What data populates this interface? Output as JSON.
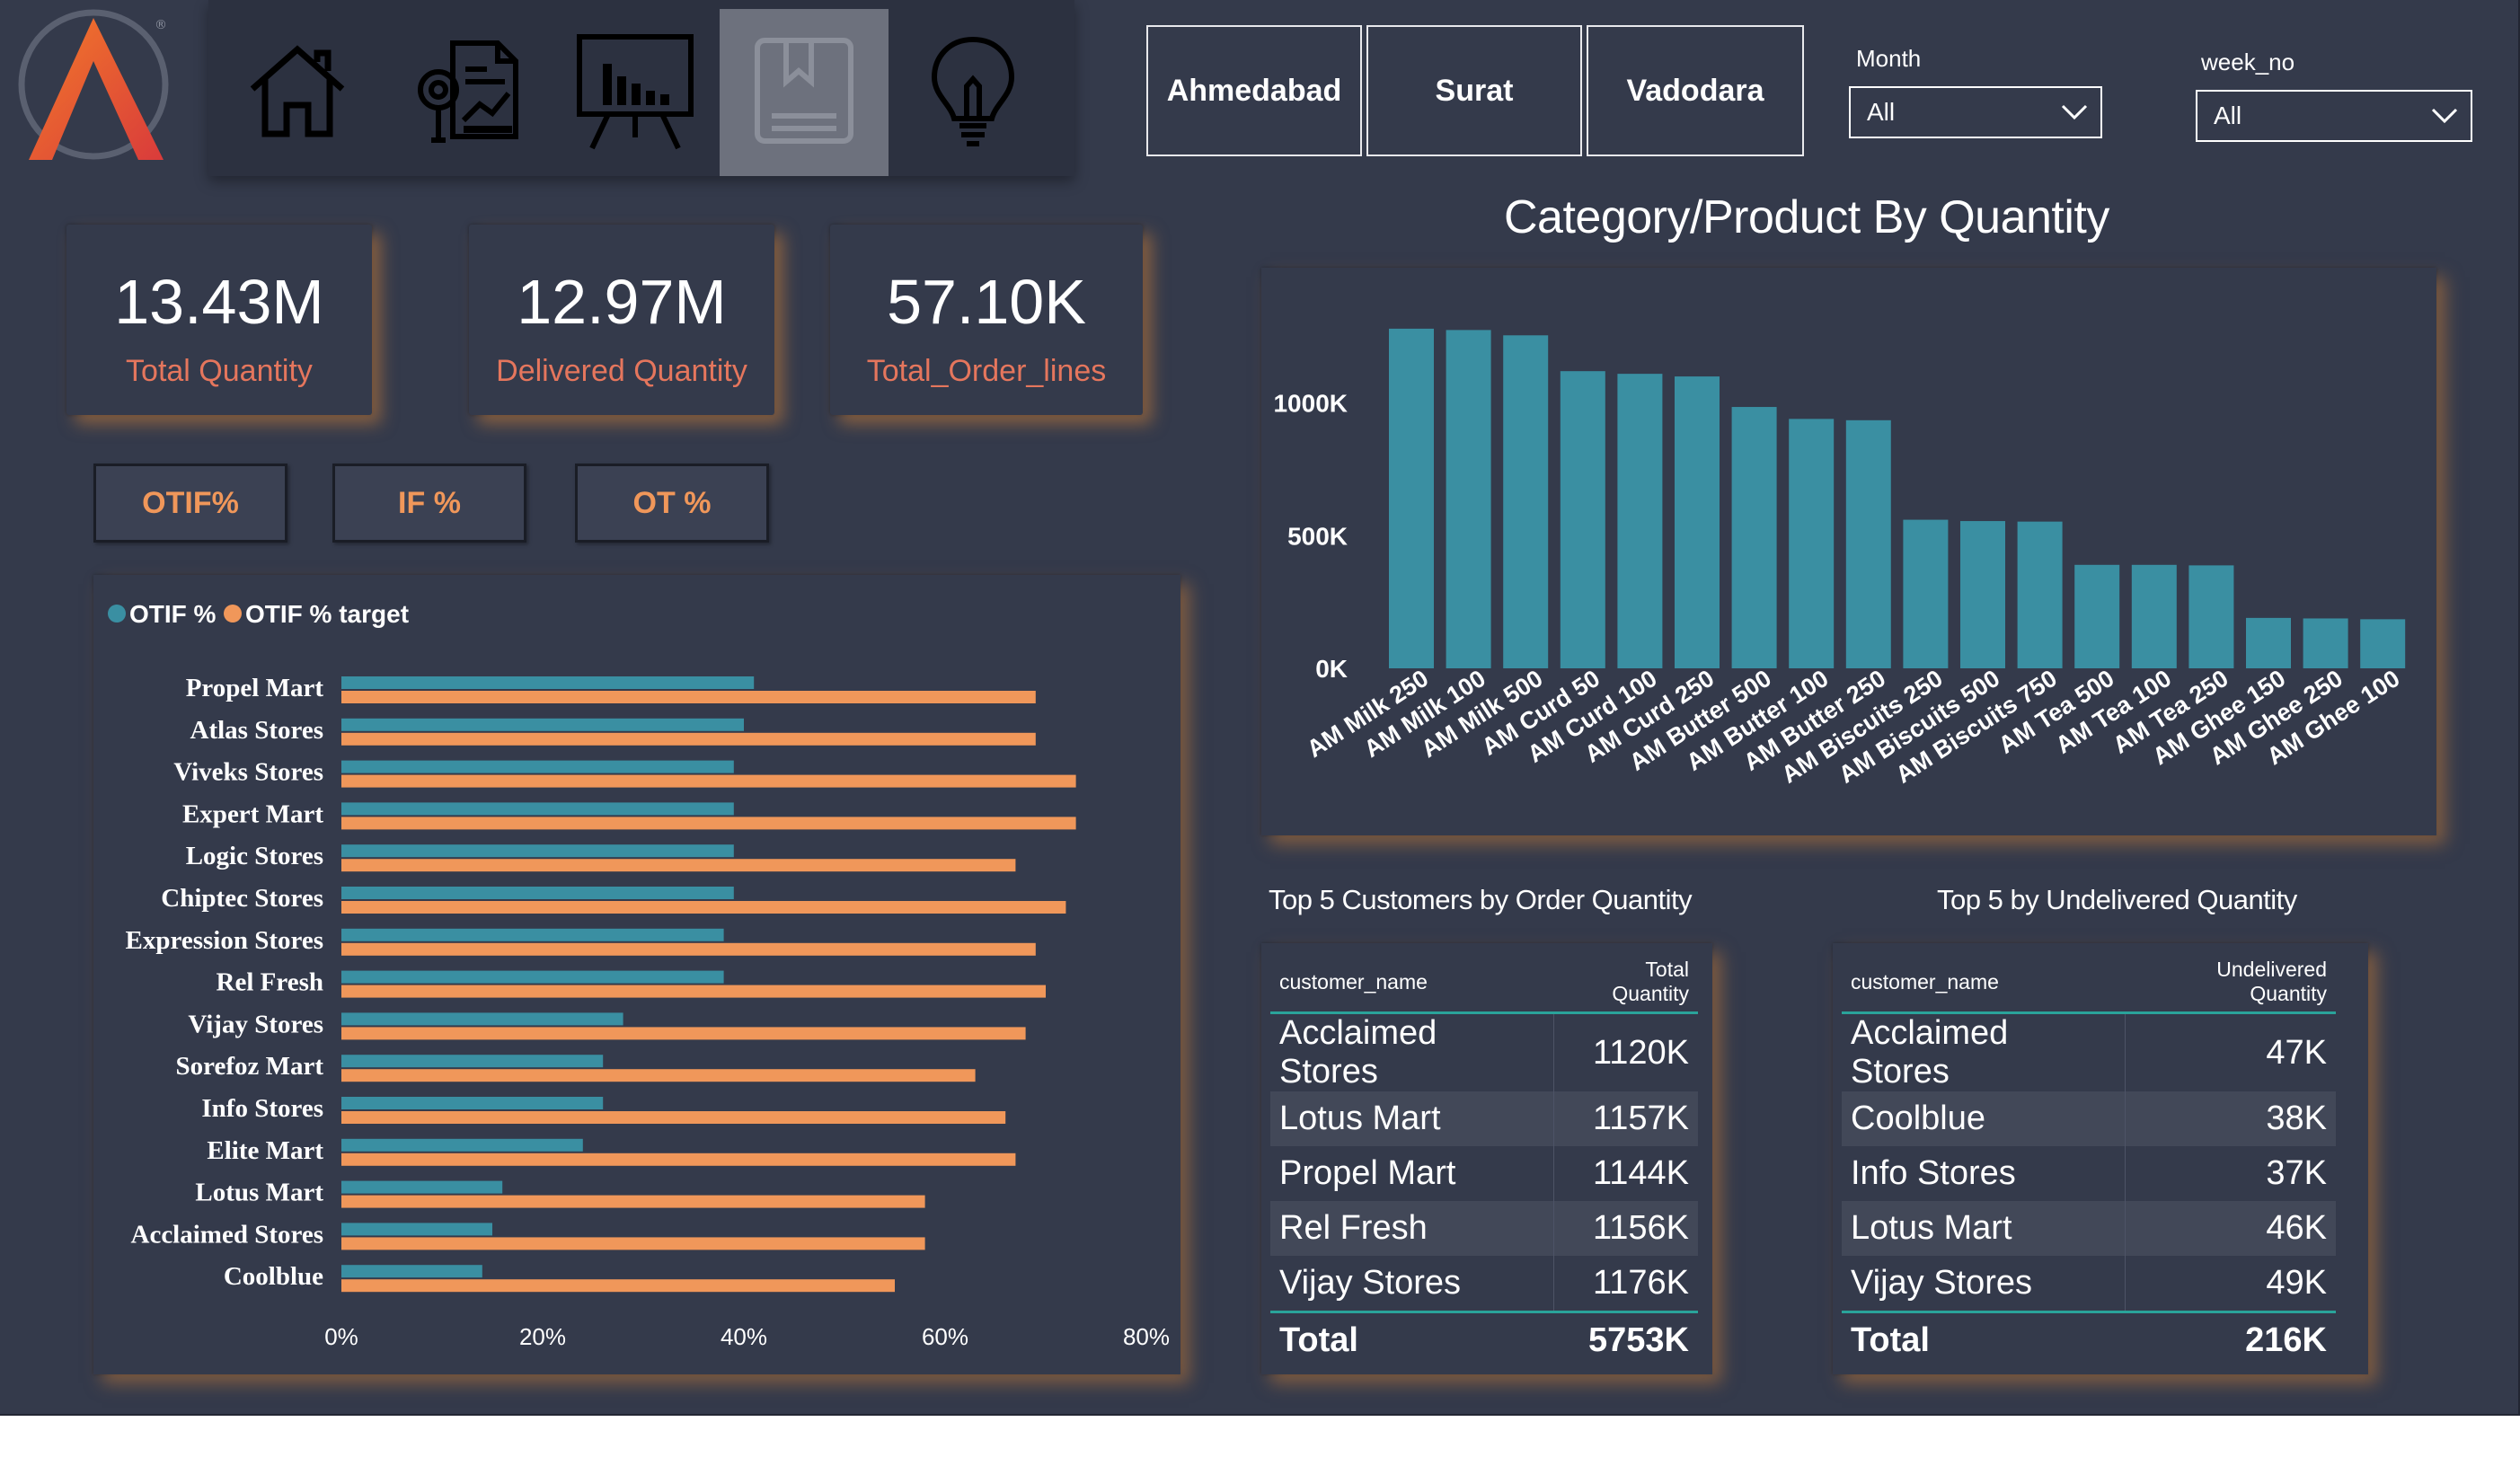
{
  "nav": {
    "items": [
      {
        "name": "home-icon",
        "active": false
      },
      {
        "name": "report-analysis-icon",
        "active": false
      },
      {
        "name": "presentation-chart-icon",
        "active": false
      },
      {
        "name": "bookmark-icon",
        "active": true
      },
      {
        "name": "lightbulb-icon",
        "active": false
      }
    ]
  },
  "cities": [
    "Ahmedabad",
    "Surat",
    "Vadodara"
  ],
  "filters": {
    "month": {
      "label": "Month",
      "value": "All"
    },
    "week": {
      "label": "week_no",
      "value": "All"
    }
  },
  "kpis": [
    {
      "value": "13.43M",
      "label": "Total Quantity"
    },
    {
      "value": "12.97M",
      "label": "Delivered Quantity"
    },
    {
      "value": "57.10K",
      "label": "Total_Order_lines"
    }
  ],
  "metric_buttons": [
    "OTIF%",
    "IF %",
    "OT %"
  ],
  "colors": {
    "background": "#343a4b",
    "accent_teal": "#3a8fa2",
    "accent_orange": "#f0975a",
    "kpi_label": "#e5765d"
  },
  "chart_data": [
    {
      "type": "bar",
      "orientation": "horizontal",
      "legend": "top-left",
      "categories": [
        "Propel Mart",
        "Atlas Stores",
        "Viveks Stores",
        "Expert Mart",
        "Logic Stores",
        "Chiptec Stores",
        "Expression Stores",
        "Rel Fresh",
        "Vijay Stores",
        "Sorefoz Mart",
        "Info Stores",
        "Elite Mart",
        "Lotus Mart",
        "Acclaimed Stores",
        "Coolblue"
      ],
      "series": [
        {
          "name": "OTIF %",
          "color": "#3a8fa2",
          "values": [
            41,
            40,
            39,
            39,
            39,
            39,
            38,
            38,
            28,
            26,
            26,
            24,
            16,
            15,
            14
          ]
        },
        {
          "name": "OTIF % target",
          "color": "#f0975a",
          "values": [
            69,
            69,
            73,
            73,
            67,
            72,
            69,
            70,
            68,
            63,
            66,
            67,
            58,
            58,
            55
          ]
        }
      ],
      "xticks": [
        "0%",
        "20%",
        "40%",
        "60%",
        "80%"
      ],
      "xlim": [
        0,
        80
      ]
    },
    {
      "type": "bar",
      "title": "Category/Product By Quantity",
      "categories": [
        "AM Milk 250",
        "AM Milk 100",
        "AM Milk 500",
        "AM Curd 50",
        "AM Curd 100",
        "AM Curd 250",
        "AM Butter 500",
        "AM Butter 100",
        "AM Butter 250",
        "AM Biscuits 250",
        "AM Biscuits 500",
        "AM Biscuits 750",
        "AM Tea 500",
        "AM Tea 100",
        "AM Tea 250",
        "AM Ghee 150",
        "AM Ghee 250",
        "AM Ghee 100"
      ],
      "values": [
        1280,
        1275,
        1255,
        1120,
        1110,
        1100,
        985,
        940,
        935,
        560,
        555,
        553,
        390,
        390,
        388,
        190,
        188,
        185
      ],
      "yticks": [
        "0K",
        "500K",
        "1000K"
      ],
      "ylim": [
        0,
        1300
      ],
      "color": "#3a8fa2"
    }
  ],
  "top_customers": {
    "title": "Top 5 Customers by Order Quantity",
    "col1": "customer_name",
    "col2": "Total Quantity",
    "rows": [
      {
        "name": "Acclaimed Stores",
        "value": "1120K"
      },
      {
        "name": "Lotus Mart",
        "value": "1157K"
      },
      {
        "name": "Propel Mart",
        "value": "1144K"
      },
      {
        "name": "Rel Fresh",
        "value": "1156K"
      },
      {
        "name": "Vijay Stores",
        "value": "1176K"
      }
    ],
    "total_label": "Total",
    "total_value": "5753K"
  },
  "top_undelivered": {
    "title": "Top 5 by Undelivered Quantity",
    "col1": "customer_name",
    "col2": "Undelivered Quantity",
    "rows": [
      {
        "name": "Acclaimed Stores",
        "value": "47K"
      },
      {
        "name": "Coolblue",
        "value": "38K"
      },
      {
        "name": "Info Stores",
        "value": "37K"
      },
      {
        "name": "Lotus Mart",
        "value": "46K"
      },
      {
        "name": "Vijay Stores",
        "value": "49K"
      }
    ],
    "total_label": "Total",
    "total_value": "216K"
  }
}
